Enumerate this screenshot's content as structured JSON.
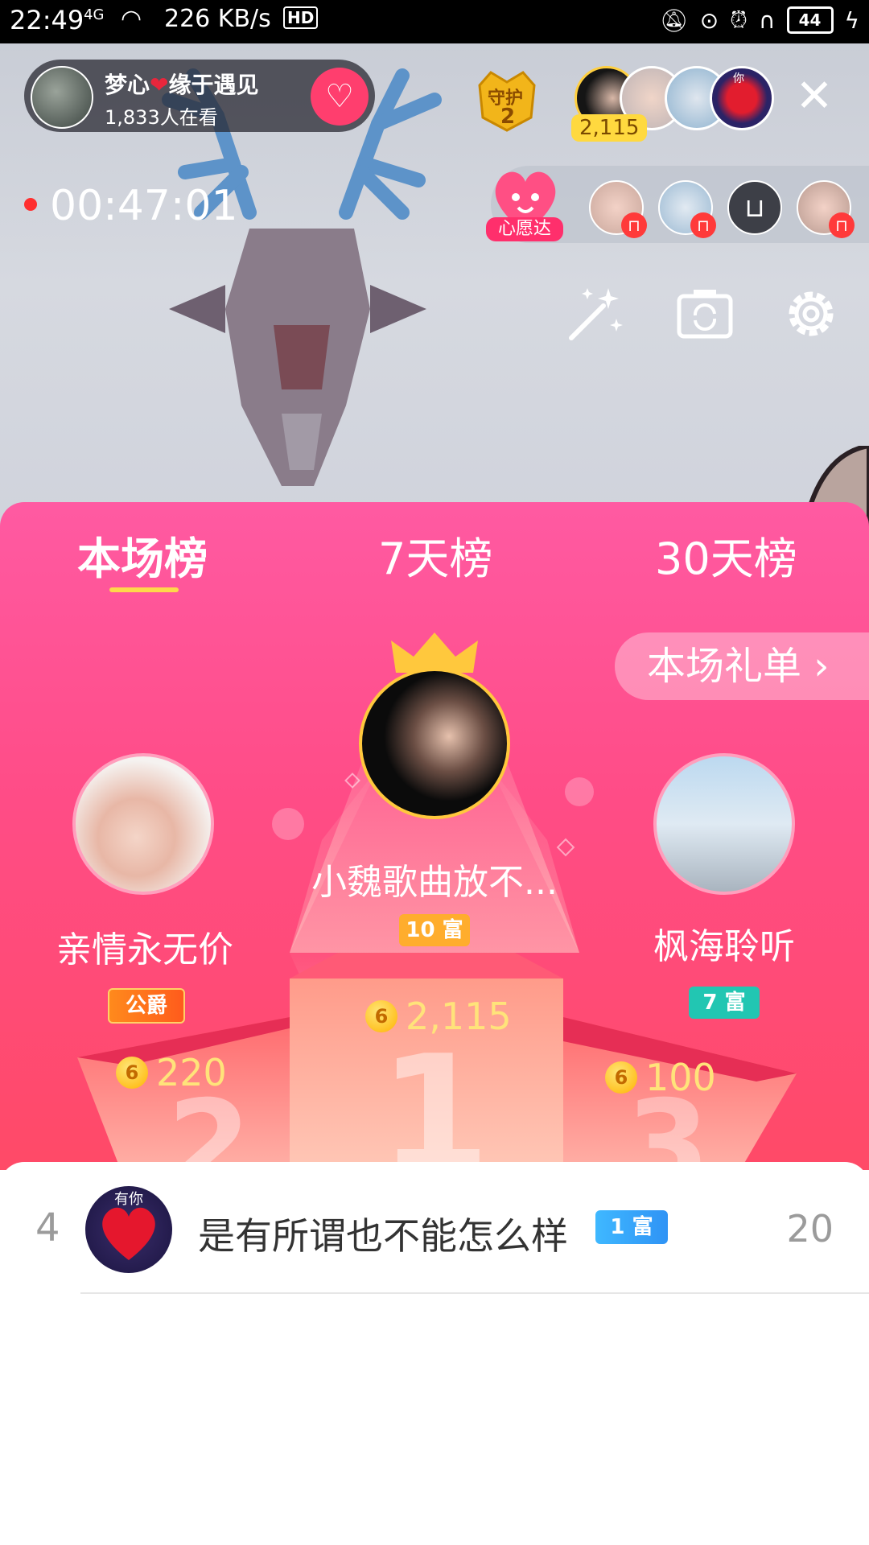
{
  "status_bar": {
    "time": "22:49",
    "network": "4G",
    "speed": "226 KB/s",
    "hd": "HD",
    "battery": "44"
  },
  "live": {
    "host_name_left": "梦心",
    "host_name_right": "缘于遇见",
    "viewers": "1,833人在看",
    "guard_label": "守护",
    "guard_count": "2",
    "top_viewer_count": "2,115",
    "timer": "00:47:01",
    "wish_label": "心愿达",
    "top_viewer_letter": "你"
  },
  "tabs": [
    {
      "label": "本场榜",
      "active": true
    },
    {
      "label": "7天榜",
      "active": false
    },
    {
      "label": "30天榜",
      "active": false
    }
  ],
  "gift_list_link": "本场礼单 ›",
  "podium": {
    "first": {
      "name": "小魏歌曲放不...",
      "badge": "10 富",
      "coins": "2,115",
      "place": "1"
    },
    "second": {
      "name": "亲情永无价",
      "badge": "公爵",
      "coins": "220",
      "place": "2"
    },
    "third": {
      "name": "枫海聆听",
      "badge": "7 富",
      "coins": "100",
      "place": "3"
    }
  },
  "coin_glyph": "6",
  "list": [
    {
      "rank": "4",
      "name": "是有所谓也不能怎么样",
      "badge": "1 富",
      "score": "20",
      "avatar_text": "有你"
    }
  ],
  "colors": {
    "panel_top": "#ff5aa2",
    "panel_bottom": "#ff4a67",
    "accent_yellow": "#ffd84a",
    "coin": "#ffb300"
  }
}
